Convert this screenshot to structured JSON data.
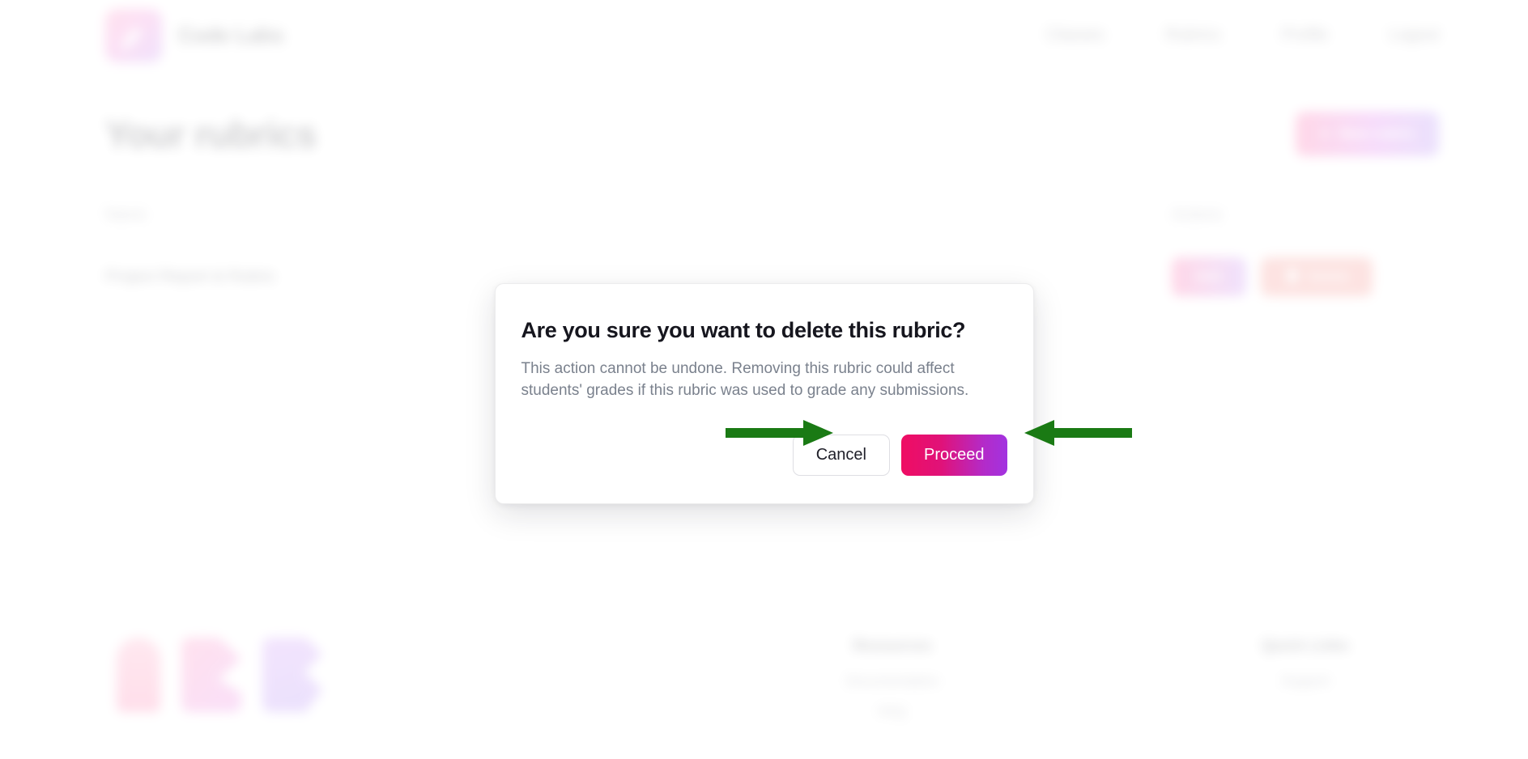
{
  "header": {
    "brand_name": "Code Labs",
    "logo_icon": "pencil-logo-icon",
    "nav": [
      {
        "label": "Classes"
      },
      {
        "label": "Rubrics"
      },
      {
        "label": "Profile"
      },
      {
        "label": "Logout"
      }
    ]
  },
  "main": {
    "page_title": "Your rubrics",
    "new_rubric_button": {
      "label": "New rubric",
      "icon": "plus-icon"
    },
    "table": {
      "columns": [
        "Name",
        "Actions"
      ],
      "rows": [
        {
          "name": "Project Report & Rubric",
          "edit_label": "Edit",
          "delete_label": "Delete",
          "delete_icon": "trash-icon"
        }
      ]
    }
  },
  "footer": {
    "marks": [
      "mark-pink-rounded",
      "mark-pink-b",
      "mark-purple-r"
    ],
    "columns": [
      {
        "title": "Resources",
        "links": [
          "Documentation",
          "FAQ"
        ]
      },
      {
        "title": "Quick Links",
        "links": [
          "Support"
        ]
      }
    ]
  },
  "modal": {
    "title": "Are you sure you want to delete this rubric?",
    "body": "This action cannot be undone. Removing this rubric could affect students' grades if this rubric was used to grade any submissions.",
    "cancel_label": "Cancel",
    "proceed_label": "Proceed"
  },
  "annotations": {
    "arrow_color": "#1a7a14",
    "left_arrow": "points-right-at-cancel",
    "right_arrow": "points-left-at-proceed"
  },
  "colors": {
    "accent_pink": "#ef0d63",
    "accent_purple": "#a233e0",
    "delete_red": "#f4756e",
    "body_text": "#7a818d",
    "title_text": "#16161e",
    "annotation_green": "#1a7a14"
  }
}
